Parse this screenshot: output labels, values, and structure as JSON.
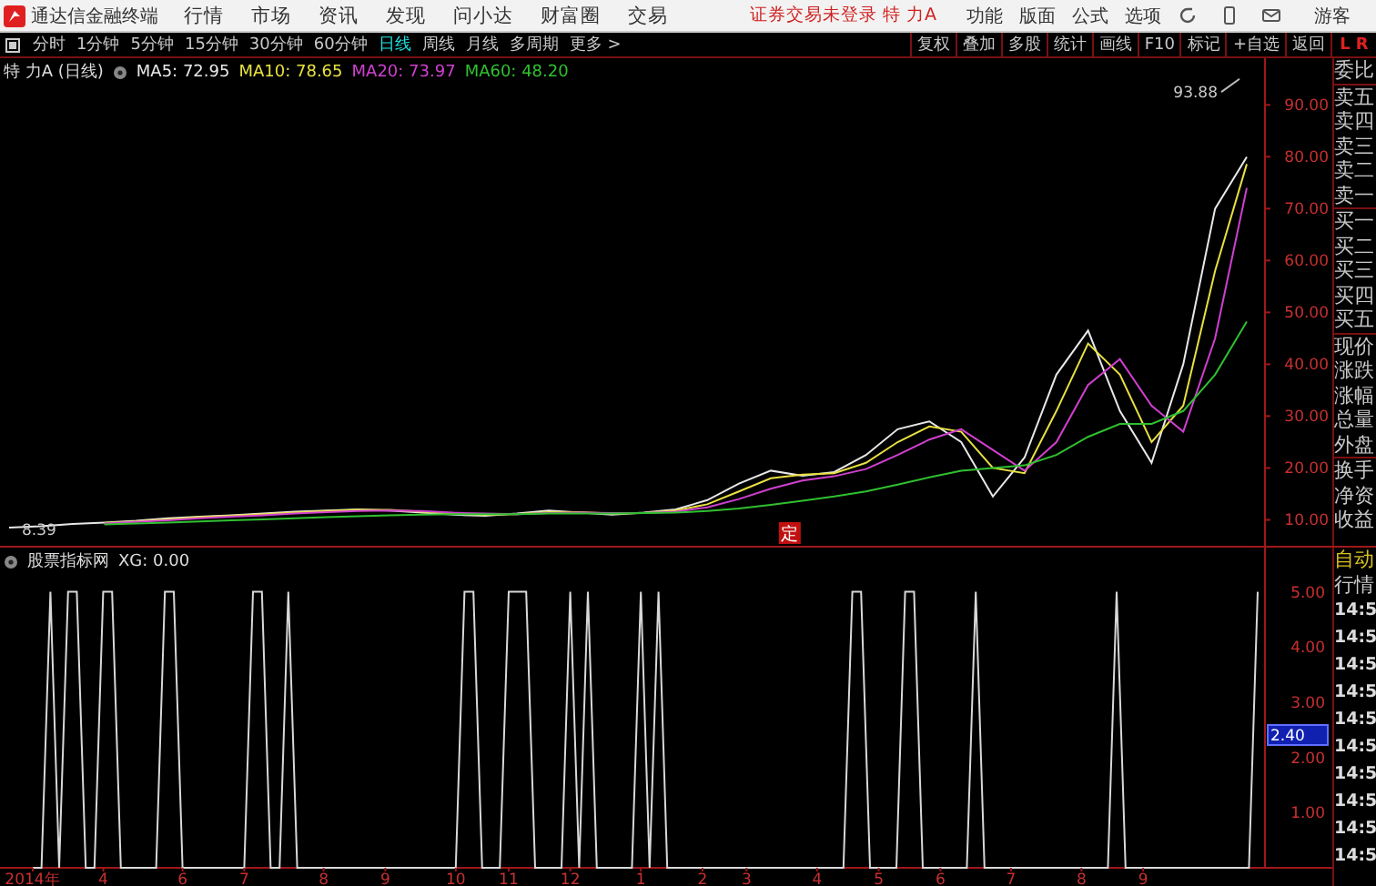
{
  "app_bar": {
    "app_name": "通达信金融终端",
    "menu": [
      "行情",
      "市场",
      "资讯",
      "发现",
      "问小达",
      "财富圈",
      "交易"
    ],
    "notice": "证券交易未登录  特 力A",
    "right_menu": [
      "功能",
      "版面",
      "公式",
      "选项"
    ],
    "user": "游客"
  },
  "toolbar": {
    "periods": [
      {
        "label": "分时",
        "selected": false
      },
      {
        "label": "1分钟",
        "selected": false
      },
      {
        "label": "5分钟",
        "selected": false
      },
      {
        "label": "15分钟",
        "selected": false
      },
      {
        "label": "30分钟",
        "selected": false
      },
      {
        "label": "60分钟",
        "selected": false
      },
      {
        "label": "日线",
        "selected": true
      },
      {
        "label": "周线",
        "selected": false
      },
      {
        "label": "月线",
        "selected": false
      },
      {
        "label": "多周期",
        "selected": false
      },
      {
        "label": "更多 >",
        "selected": false
      }
    ],
    "actions": [
      "复权",
      "叠加",
      "多股",
      "统计",
      "画线",
      "F10",
      "标记",
      "+自选",
      "返回"
    ],
    "corner": [
      "L",
      "R"
    ]
  },
  "price_chart": {
    "title": "特 力A (日线)",
    "chart_data": {
      "type": "line",
      "ylim": [
        5,
        99
      ],
      "yticks": [
        {
          "value": 10,
          "label": "10.00"
        },
        {
          "value": 20,
          "label": "20.00"
        },
        {
          "value": 30,
          "label": "30.00"
        },
        {
          "value": 40,
          "label": "40.00"
        },
        {
          "value": 50,
          "label": "50.00"
        },
        {
          "value": 60,
          "label": "60.00"
        },
        {
          "value": 70,
          "label": "70.00"
        },
        {
          "value": 80,
          "label": "80.00"
        },
        {
          "value": 90,
          "label": "90.00"
        }
      ],
      "series": [
        {
          "name": "MA5: 72.95",
          "color": "#e8e8e8",
          "values": [
            8.5,
            8.8,
            9.2,
            9.5,
            9.8,
            10.3,
            10.6,
            10.9,
            11.2,
            11.6,
            11.8,
            12.0,
            11.8,
            11.4,
            11.0,
            10.8,
            11.2,
            11.8,
            11.4,
            11.0,
            11.4,
            12.0,
            13.8,
            17.0,
            19.5,
            18.5,
            19.2,
            22.5,
            27.5,
            29.0,
            25.0,
            14.5,
            22.0,
            38.0,
            46.5,
            31.0,
            21.0,
            40.0,
            70.0,
            80.0
          ]
        },
        {
          "name": "MA10: 78.65",
          "color": "#e8e040",
          "values": [
            null,
            null,
            null,
            9.4,
            9.7,
            10.1,
            10.5,
            10.8,
            11.1,
            11.4,
            11.7,
            11.9,
            11.9,
            11.6,
            11.2,
            11.0,
            11.1,
            11.5,
            11.5,
            11.2,
            11.3,
            11.8,
            13.0,
            15.5,
            18.0,
            18.7,
            19.0,
            21.0,
            25.0,
            28.0,
            27.0,
            20.0,
            19.0,
            31.0,
            44.0,
            38.0,
            25.0,
            32.0,
            58.0,
            78.6
          ]
        },
        {
          "name": "MA20: 73.97",
          "color": "#d040d0",
          "values": [
            null,
            null,
            null,
            9.3,
            9.6,
            9.9,
            10.3,
            10.6,
            10.9,
            11.2,
            11.5,
            11.7,
            11.8,
            11.7,
            11.4,
            11.2,
            11.1,
            11.3,
            11.4,
            11.3,
            11.3,
            11.6,
            12.4,
            14.0,
            16.0,
            17.6,
            18.4,
            19.8,
            22.5,
            25.5,
            27.5,
            23.5,
            19.5,
            25.0,
            36.0,
            41.0,
            32.0,
            27.0,
            45.0,
            74.0
          ]
        },
        {
          "name": "MA60: 48.20",
          "color": "#30c030",
          "values": [
            null,
            null,
            null,
            9.1,
            9.3,
            9.5,
            9.7,
            9.9,
            10.1,
            10.3,
            10.5,
            10.7,
            10.9,
            11.0,
            11.1,
            11.1,
            11.1,
            11.2,
            11.2,
            11.2,
            11.3,
            11.4,
            11.7,
            12.2,
            12.9,
            13.7,
            14.5,
            15.5,
            16.8,
            18.2,
            19.5,
            20.0,
            20.5,
            22.5,
            26.0,
            28.5,
            28.5,
            31.0,
            38.0,
            48.2
          ]
        }
      ],
      "annotations": [
        "93.88",
        "8.39",
        "定"
      ]
    }
  },
  "indicator_chart": {
    "title": "股票指标网",
    "cursor_reading": "2.40",
    "chart_data": {
      "type": "line",
      "categories": [
        "2014年",
        null,
        null,
        null,
        null,
        null,
        null,
        null,
        "4",
        null,
        null,
        null,
        null,
        null,
        null,
        null,
        null,
        "6",
        null,
        null,
        null,
        null,
        null,
        null,
        "7",
        null,
        null,
        null,
        null,
        null,
        null,
        null,
        null,
        "8",
        null,
        null,
        null,
        null,
        null,
        null,
        "9",
        null,
        null,
        null,
        null,
        null,
        null,
        null,
        "10",
        null,
        null,
        null,
        null,
        null,
        "11",
        null,
        null,
        null,
        null,
        null,
        null,
        "12",
        null,
        null,
        null,
        null,
        null,
        null,
        null,
        "1",
        null,
        null,
        null,
        null,
        null,
        null,
        "2",
        null,
        null,
        null,
        null,
        "3",
        null,
        null,
        null,
        null,
        null,
        null,
        null,
        "4",
        null,
        null,
        null,
        null,
        null,
        null,
        "5",
        null,
        null,
        null,
        null,
        null,
        null,
        "6",
        null,
        null,
        null,
        null,
        null,
        null,
        null,
        "7",
        null,
        null,
        null,
        null,
        null,
        null,
        null,
        "8",
        null,
        null,
        null,
        null,
        null,
        null,
        "9",
        null,
        null,
        null,
        null,
        null,
        null,
        null,
        null,
        null,
        null,
        null,
        null,
        null
      ],
      "ylim": [
        0,
        5.8
      ],
      "yticks": [
        {
          "value": 1,
          "label": "1.00"
        },
        {
          "value": 2,
          "label": "2.00"
        },
        {
          "value": 3,
          "label": "3.00"
        },
        {
          "value": 4,
          "label": "4.00"
        },
        {
          "value": 5,
          "label": "5.00"
        }
      ],
      "series": [
        {
          "name": "XG: 0.00",
          "color": "#d8d8d8",
          "values": [
            0,
            0,
            5,
            0,
            5,
            5,
            0,
            0,
            5,
            5,
            0,
            0,
            0,
            0,
            0,
            5,
            5,
            0,
            0,
            0,
            0,
            0,
            0,
            0,
            0,
            5,
            5,
            0,
            0,
            5,
            0,
            0,
            0,
            0,
            0,
            0,
            0,
            0,
            0,
            0,
            0,
            0,
            0,
            0,
            0,
            0,
            0,
            0,
            0,
            5,
            5,
            0,
            0,
            0,
            5,
            5,
            5,
            0,
            0,
            0,
            0,
            5,
            0,
            5,
            0,
            0,
            0,
            0,
            0,
            5,
            0,
            5,
            0,
            0,
            0,
            0,
            0,
            0,
            0,
            0,
            0,
            0,
            0,
            0,
            0,
            0,
            0,
            0,
            0,
            0,
            0,
            0,
            0,
            5,
            5,
            0,
            0,
            0,
            0,
            5,
            5,
            0,
            0,
            0,
            0,
            0,
            0,
            5,
            0,
            0,
            0,
            0,
            0,
            0,
            0,
            0,
            0,
            0,
            0,
            0,
            0,
            0,
            0,
            5,
            0,
            0,
            0,
            0,
            0,
            0,
            0,
            0,
            0,
            0,
            0,
            0,
            0,
            0,
            0,
            5
          ]
        }
      ]
    }
  },
  "quote_panel": {
    "groups": [
      [
        "委比"
      ],
      [
        "卖五",
        "卖四",
        "卖三",
        "卖二",
        "卖一"
      ],
      [
        "买一",
        "买二",
        "买三",
        "买四",
        "买五"
      ],
      [
        "现价",
        "涨跌",
        "涨幅",
        "总量",
        "外盘"
      ],
      [
        "换手",
        "净资",
        "收益"
      ]
    ]
  },
  "ticks_panel": {
    "mode": "自动",
    "title": "行情",
    "times": [
      "14:5",
      "14:5",
      "14:5",
      "14:5",
      "14:5",
      "14:5",
      "14:5",
      "14:5",
      "14:5",
      "14:5"
    ]
  }
}
